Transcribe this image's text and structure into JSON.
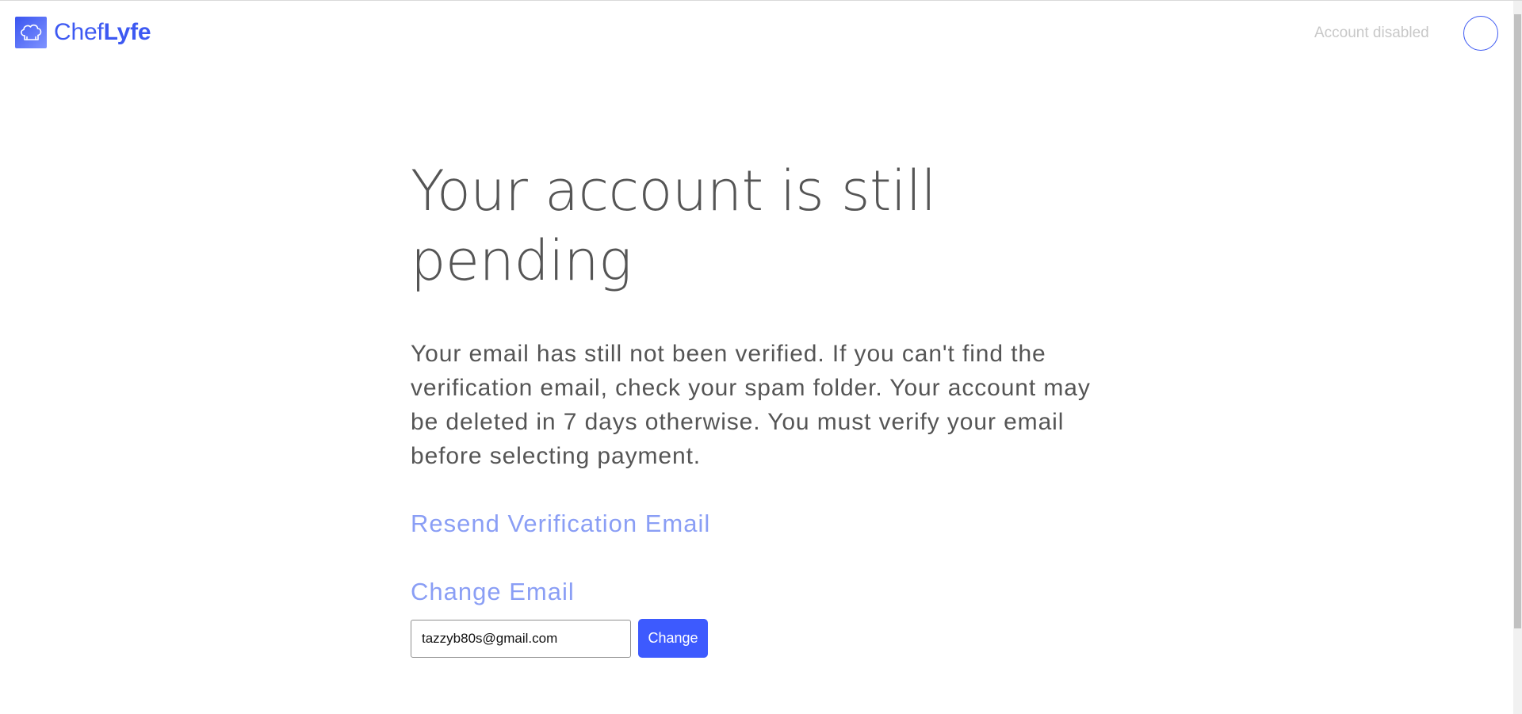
{
  "header": {
    "brand": {
      "icon": "chef-hat-icon",
      "name_light": "Chef",
      "name_bold": "Lyfe"
    },
    "account_status": "Account disabled",
    "avatar_icon": "user-avatar-icon"
  },
  "main": {
    "title": "Your account is still pending",
    "message": "Your email has still not been verified. If you can't find the verification email, check your spam folder. Your account may be deleted in 7 days otherwise. You must verify your email before selecting payment.",
    "resend_link": "Resend Verification Email",
    "change_email_heading": "Change Email",
    "email_value": "tazzyb80s@gmail.com",
    "change_button": "Change"
  },
  "colors": {
    "brand": "#3d59f2",
    "link": "#8a9ef5",
    "button": "#3d5afe",
    "text": "#555555",
    "muted": "#c8c8c8"
  }
}
